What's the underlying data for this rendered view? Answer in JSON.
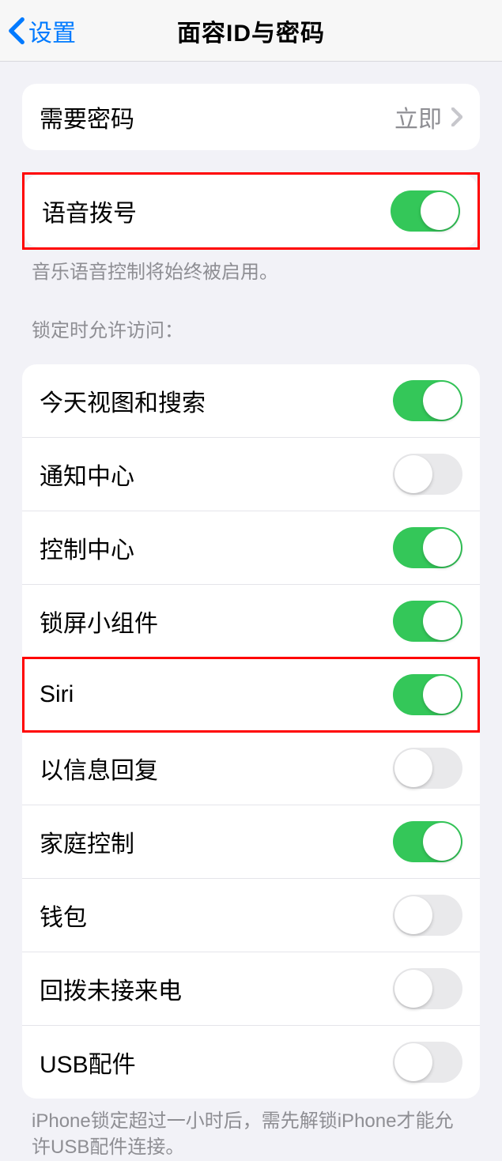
{
  "navbar": {
    "back_label": "设置",
    "title": "面容ID与密码"
  },
  "passcode_group": {
    "require_passcode_label": "需要密码",
    "require_passcode_value": "立即"
  },
  "voice_dial": {
    "label": "语音拨号",
    "on": true,
    "footer": "音乐语音控制将始终被启用。"
  },
  "lock_access_header": "锁定时允许访问：",
  "lock_access_items": [
    {
      "label": "今天视图和搜索",
      "on": true,
      "highlighted": false
    },
    {
      "label": "通知中心",
      "on": false,
      "highlighted": false
    },
    {
      "label": "控制中心",
      "on": true,
      "highlighted": false
    },
    {
      "label": "锁屏小组件",
      "on": true,
      "highlighted": false
    },
    {
      "label": "Siri",
      "on": true,
      "highlighted": true
    },
    {
      "label": "以信息回复",
      "on": false,
      "highlighted": false
    },
    {
      "label": "家庭控制",
      "on": true,
      "highlighted": false
    },
    {
      "label": "钱包",
      "on": false,
      "highlighted": false
    },
    {
      "label": "回拨未接来电",
      "on": false,
      "highlighted": false
    },
    {
      "label": "USB配件",
      "on": false,
      "highlighted": false
    }
  ],
  "usb_footer": "iPhone锁定超过一小时后，需先解锁iPhone才能允许USB配件连接。"
}
